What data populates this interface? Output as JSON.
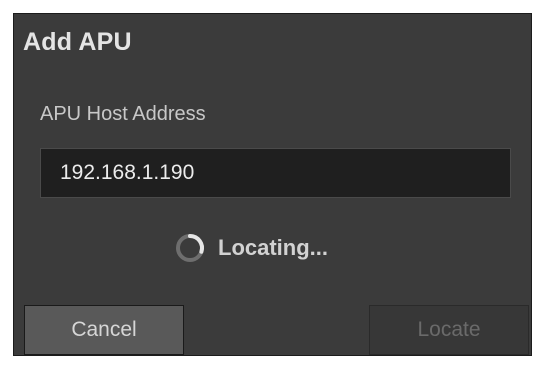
{
  "dialog": {
    "title": "Add APU",
    "host_label": "APU Host Address",
    "host_value": "192.168.1.190",
    "status_text": "Locating...",
    "status_icon": "spinner-icon",
    "buttons": {
      "cancel_label": "Cancel",
      "locate_label": "Locate",
      "locate_enabled": false
    }
  },
  "colors": {
    "dialog_bg": "#3b3b3b",
    "input_bg": "#1f1f1f",
    "text": "#cfcfcf",
    "disabled_text": "#6a6a6a"
  }
}
